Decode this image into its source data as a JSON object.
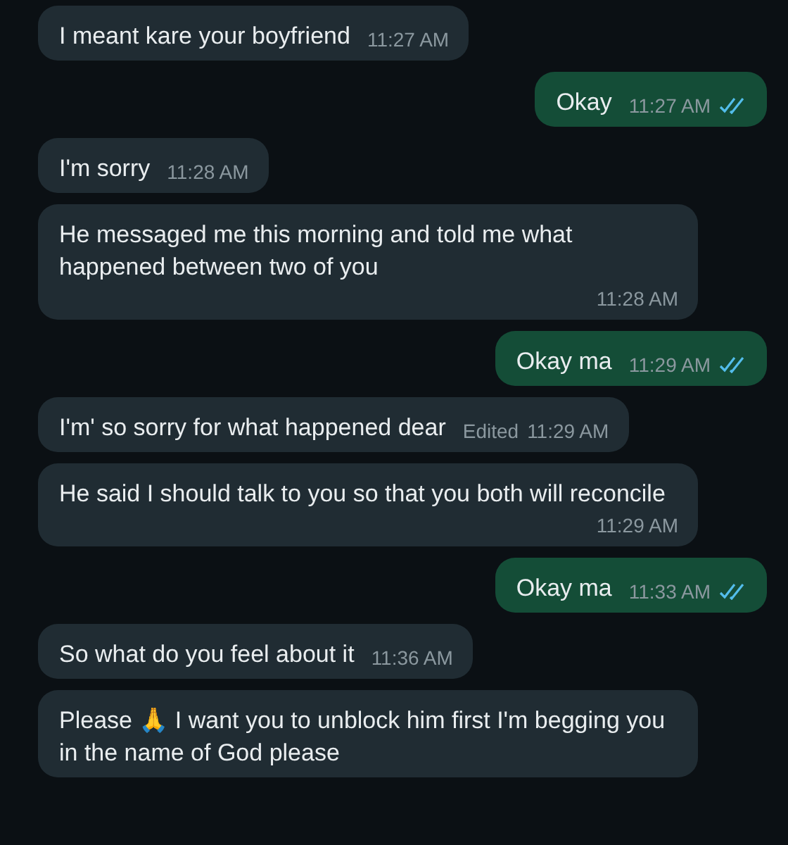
{
  "messages": [
    {
      "kind": "incoming",
      "text": "I meant kare your boyfriend",
      "time": "11:27 AM"
    },
    {
      "kind": "outgoing",
      "text": "Okay",
      "time": "11:27 AM",
      "read": true
    },
    {
      "kind": "incoming",
      "text": "I'm sorry",
      "time": "11:28 AM"
    },
    {
      "kind": "incoming",
      "text": "He messaged me this morning and told me what happened between two of you",
      "time": "11:28 AM"
    },
    {
      "kind": "outgoing",
      "text": "Okay ma",
      "time": "11:29 AM",
      "read": true
    },
    {
      "kind": "incoming",
      "text": "I'm' so sorry for what happened dear",
      "time": "11:29 AM",
      "edited": "Edited"
    },
    {
      "kind": "incoming",
      "text": "He said I should talk to you so that you both will reconcile",
      "time": "11:29 AM"
    },
    {
      "kind": "outgoing",
      "text": "Okay ma",
      "time": "11:33 AM",
      "read": true
    },
    {
      "kind": "incoming",
      "text": "So what do you feel about it",
      "time": "11:36 AM"
    },
    {
      "kind": "incoming",
      "text": "Please 🙏 I want you to unblock him first I'm begging you in the name of God please"
    }
  ]
}
